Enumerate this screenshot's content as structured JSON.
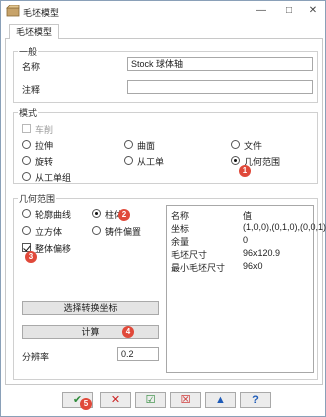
{
  "window": {
    "title": "毛坯模型",
    "minimize_glyph": "—",
    "maximize_glyph": "□",
    "close_glyph": "✕"
  },
  "tab": {
    "label": "毛坯模型"
  },
  "general": {
    "group_label": "一般",
    "name_label": "名称",
    "name_value": "Stock 球体轴",
    "comment_label": "注释",
    "comment_value": ""
  },
  "mode": {
    "group_label": "模式",
    "turning_label": "车削",
    "options": {
      "extrude": "拉伸",
      "surface": "曲面",
      "file": "文件",
      "revolve": "旋转",
      "from_work": "从工单",
      "geometry_range": "几何范围",
      "from_work_unit": "从工单组"
    },
    "selected": "geometry_range"
  },
  "geometry": {
    "group_label": "几何范围",
    "options": {
      "contour": "轮廓曲线",
      "cylinder": "柱体",
      "cube": "立方体",
      "part_offset": "铸件偏置"
    },
    "selected": "cylinder",
    "overall_offset_label": "整体偏移",
    "overall_offset_checked": true,
    "select_transform_button": "选择转换坐标",
    "compute_button": "计算",
    "resolution_label": "分辨率",
    "resolution_value": "0.2"
  },
  "info_table": {
    "header": {
      "name": "名称",
      "value": "值"
    },
    "rows": [
      {
        "name": "坐标",
        "value": "(1,0,0),(0,1,0),(0,0,1)"
      },
      {
        "name": "余量",
        "value": "0"
      },
      {
        "name": "毛坯尺寸",
        "value": "96x120.9"
      },
      {
        "name": "最小毛坯尺寸",
        "value": "96x0"
      }
    ]
  },
  "annotations": {
    "step1": "1",
    "step2": "2",
    "step3": "3",
    "step4": "4",
    "step5": "5"
  },
  "toolbar": {
    "ok_glyph": "✔",
    "cancel_glyph": "✕",
    "accept_glyph": "☑",
    "reject_glyph": "☒",
    "save_glyph": "▲",
    "help_glyph": "?"
  },
  "colors": {
    "accent_red": "#e0493a",
    "ok_green": "#2e8b3a",
    "cancel_red": "#cc2222",
    "help_blue": "#1e5bb8"
  }
}
